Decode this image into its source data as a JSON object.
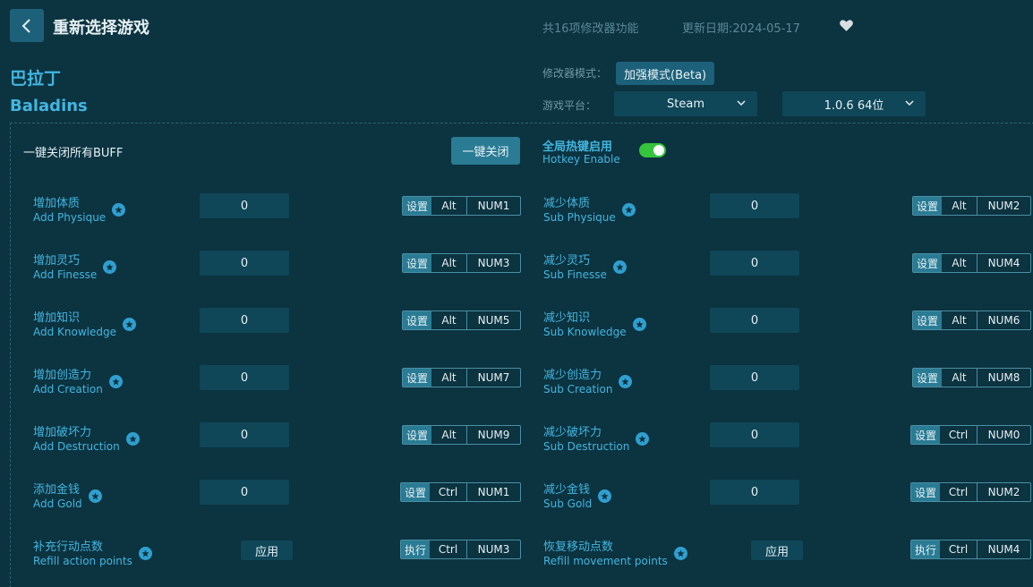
{
  "header": {
    "title": "重新选择游戏",
    "feature_count": "共16项修改器功能",
    "update_date": "更新日期:2024-05-17"
  },
  "game": {
    "name_cn": "巴拉丁",
    "name_en": "Baladins"
  },
  "settings": {
    "mode_label": "修改器模式：",
    "mode_value": "加强模式(Beta)",
    "platform_label": "游戏平台：",
    "platform_value": "Steam",
    "version_value": "1.0.6 64位"
  },
  "global": {
    "buff_label": "一键关闭所有BUFF",
    "close_all_label": "一键关闭",
    "hotkey_cn": "全局热键启用",
    "hotkey_en": "Hotkey Enable",
    "hotkey_enabled": true
  },
  "icons": {
    "back": "chevron-left-icon",
    "favorite": "heart-icon",
    "info": "star-icon",
    "dropdown": "chevron-down-icon"
  },
  "colors": {
    "accent": "#42b6e0",
    "background": "#0c3340",
    "toggle_on": "#35c43c",
    "button": "#2a7b94"
  },
  "cheats": [
    {
      "cn": "增加体质",
      "en": "Add Physique",
      "type": "value",
      "value": "0",
      "set": "设置",
      "mod": "Alt",
      "key": "NUM1"
    },
    {
      "cn": "减少体质",
      "en": "Sub Physique",
      "type": "value",
      "value": "0",
      "set": "设置",
      "mod": "Alt",
      "key": "NUM2"
    },
    {
      "cn": "增加灵巧",
      "en": "Add Finesse",
      "type": "value",
      "value": "0",
      "set": "设置",
      "mod": "Alt",
      "key": "NUM3"
    },
    {
      "cn": "减少灵巧",
      "en": "Sub Finesse",
      "type": "value",
      "value": "0",
      "set": "设置",
      "mod": "Alt",
      "key": "NUM4"
    },
    {
      "cn": "增加知识",
      "en": "Add Knowledge",
      "type": "value",
      "value": "0",
      "set": "设置",
      "mod": "Alt",
      "key": "NUM5"
    },
    {
      "cn": "减少知识",
      "en": "Sub Knowledge",
      "type": "value",
      "value": "0",
      "set": "设置",
      "mod": "Alt",
      "key": "NUM6"
    },
    {
      "cn": "增加创造力",
      "en": "Add Creation",
      "type": "value",
      "value": "0",
      "set": "设置",
      "mod": "Alt",
      "key": "NUM7"
    },
    {
      "cn": "减少创造力",
      "en": "Sub Creation",
      "type": "value",
      "value": "0",
      "set": "设置",
      "mod": "Alt",
      "key": "NUM8"
    },
    {
      "cn": "增加破坏力",
      "en": "Add Destruction",
      "type": "value",
      "value": "0",
      "set": "设置",
      "mod": "Alt",
      "key": "NUM9"
    },
    {
      "cn": "减少破坏力",
      "en": "Sub Destruction",
      "type": "value",
      "value": "0",
      "set": "设置",
      "mod": "Ctrl",
      "key": "NUM0"
    },
    {
      "cn": "添加金钱",
      "en": "Add Gold",
      "type": "value",
      "value": "0",
      "set": "设置",
      "mod": "Ctrl",
      "key": "NUM1"
    },
    {
      "cn": "减少金钱",
      "en": "Sub Gold",
      "type": "value",
      "value": "0",
      "set": "设置",
      "mod": "Ctrl",
      "key": "NUM2"
    },
    {
      "cn": "补充行动点数",
      "en": "Refill action points",
      "type": "apply",
      "value": "应用",
      "set": "执行",
      "mod": "Ctrl",
      "key": "NUM3"
    },
    {
      "cn": "恢复移动点数",
      "en": "Refill movement points",
      "type": "apply",
      "value": "应用",
      "set": "执行",
      "mod": "Ctrl",
      "key": "NUM4"
    }
  ]
}
